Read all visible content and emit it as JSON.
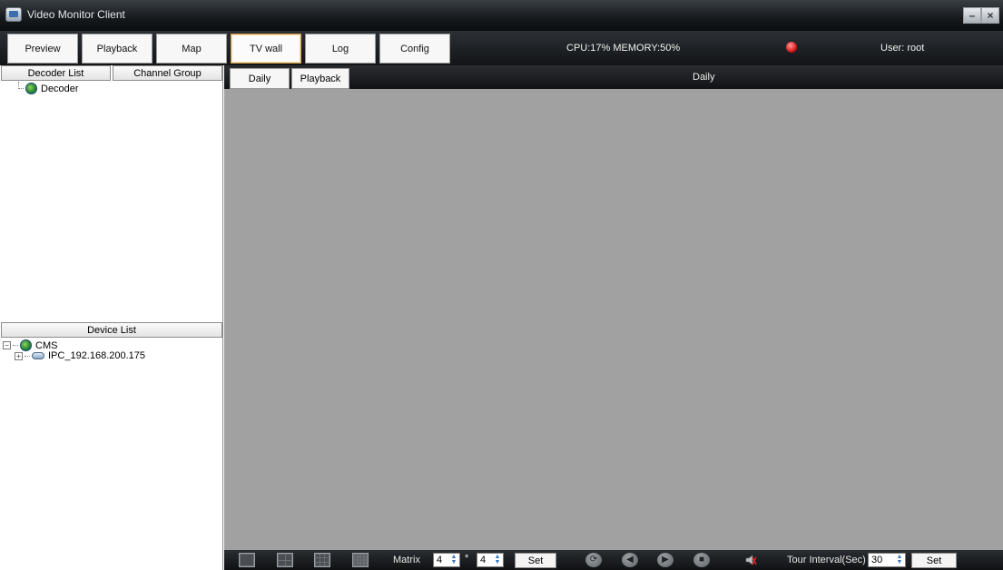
{
  "window": {
    "title": "Video Monitor Client",
    "minimize_glyph": "–",
    "close_glyph": "×"
  },
  "menu": {
    "items": [
      {
        "label": "Preview",
        "active": false
      },
      {
        "label": "Playback",
        "active": false
      },
      {
        "label": "Map",
        "active": false
      },
      {
        "label": "TV wall",
        "active": true
      },
      {
        "label": "Log",
        "active": false
      },
      {
        "label": "Config",
        "active": false
      }
    ],
    "status": "CPU:17%  MEMORY:50%",
    "user": "User: root"
  },
  "left_panel": {
    "tabs": [
      "Decoder List",
      "Channel Group"
    ],
    "decoder_tree": [
      "Decoder"
    ],
    "device_list_header": "Device List",
    "device_tree": {
      "root": "CMS",
      "children": [
        "IPC_192.168.200.175"
      ]
    }
  },
  "right_panel": {
    "tabs": [
      "Daily",
      "Playback"
    ],
    "header_label": "Daily"
  },
  "bottom_bar": {
    "matrix_label": "Matrix",
    "matrix_rows": "4",
    "matrix_sep": "*",
    "matrix_cols": "4",
    "set_label": "Set",
    "tour_interval_label": "Tour Interval(Sec)",
    "tour_interval_value": "30",
    "tour_set_label": "Set"
  },
  "colors": {
    "video_area": "#a1a1a1",
    "header_dark": "#121416",
    "active_tab_border": "#d3a14e",
    "alarm": "#d61a1a"
  },
  "icons": [
    "app-icon",
    "alarm-icon",
    "globe-icon",
    "camera-icon",
    "layout-1-icon",
    "layout-4-icon",
    "layout-9-icon",
    "layout-16-icon",
    "refresh-icon",
    "prev-icon",
    "next-icon",
    "stop-icon",
    "mute-icon"
  ]
}
